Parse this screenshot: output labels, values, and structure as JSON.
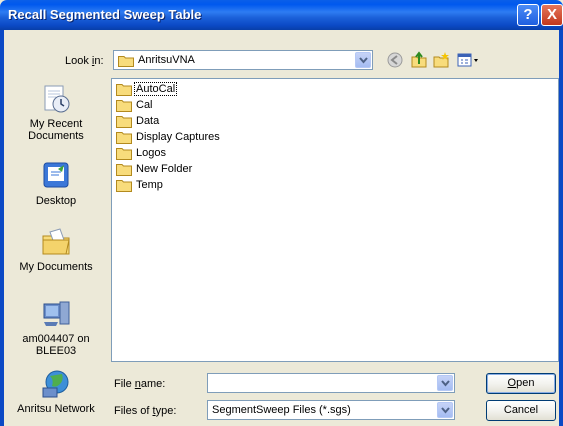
{
  "window": {
    "title": "Recall Segmented Sweep Table",
    "help_label": "?",
    "close_label": "X"
  },
  "lookin": {
    "label_pre": "Look ",
    "label_key": "i",
    "label_post": "n:",
    "value": "AnritsuVNA"
  },
  "places": [
    {
      "label": "My Recent Documents",
      "icon": "recent-documents-icon"
    },
    {
      "label": "Desktop",
      "icon": "desktop-icon"
    },
    {
      "label": "My Documents",
      "icon": "my-documents-icon"
    },
    {
      "label": "am004407 on BLEE03",
      "icon": "my-computer-icon"
    },
    {
      "label": "Anritsu Network",
      "icon": "network-places-icon"
    }
  ],
  "files": [
    "AutoCal",
    "Cal",
    "Data",
    "Display Captures",
    "Logos",
    "New Folder",
    "Temp"
  ],
  "filename": {
    "label_pre": "File ",
    "label_key": "n",
    "label_post": "ame:",
    "value": ""
  },
  "filetype": {
    "label_pre": "Files of ",
    "label_key": "t",
    "label_post": "ype:",
    "value": "SegmentSweep Files (*.sgs)"
  },
  "buttons": {
    "open_key": "O",
    "open_rest": "pen",
    "cancel": "Cancel"
  },
  "colors": {
    "titlebar": "#0058EE",
    "folder": "#F4D36B",
    "dialog_bg": "#ECE9D8"
  }
}
